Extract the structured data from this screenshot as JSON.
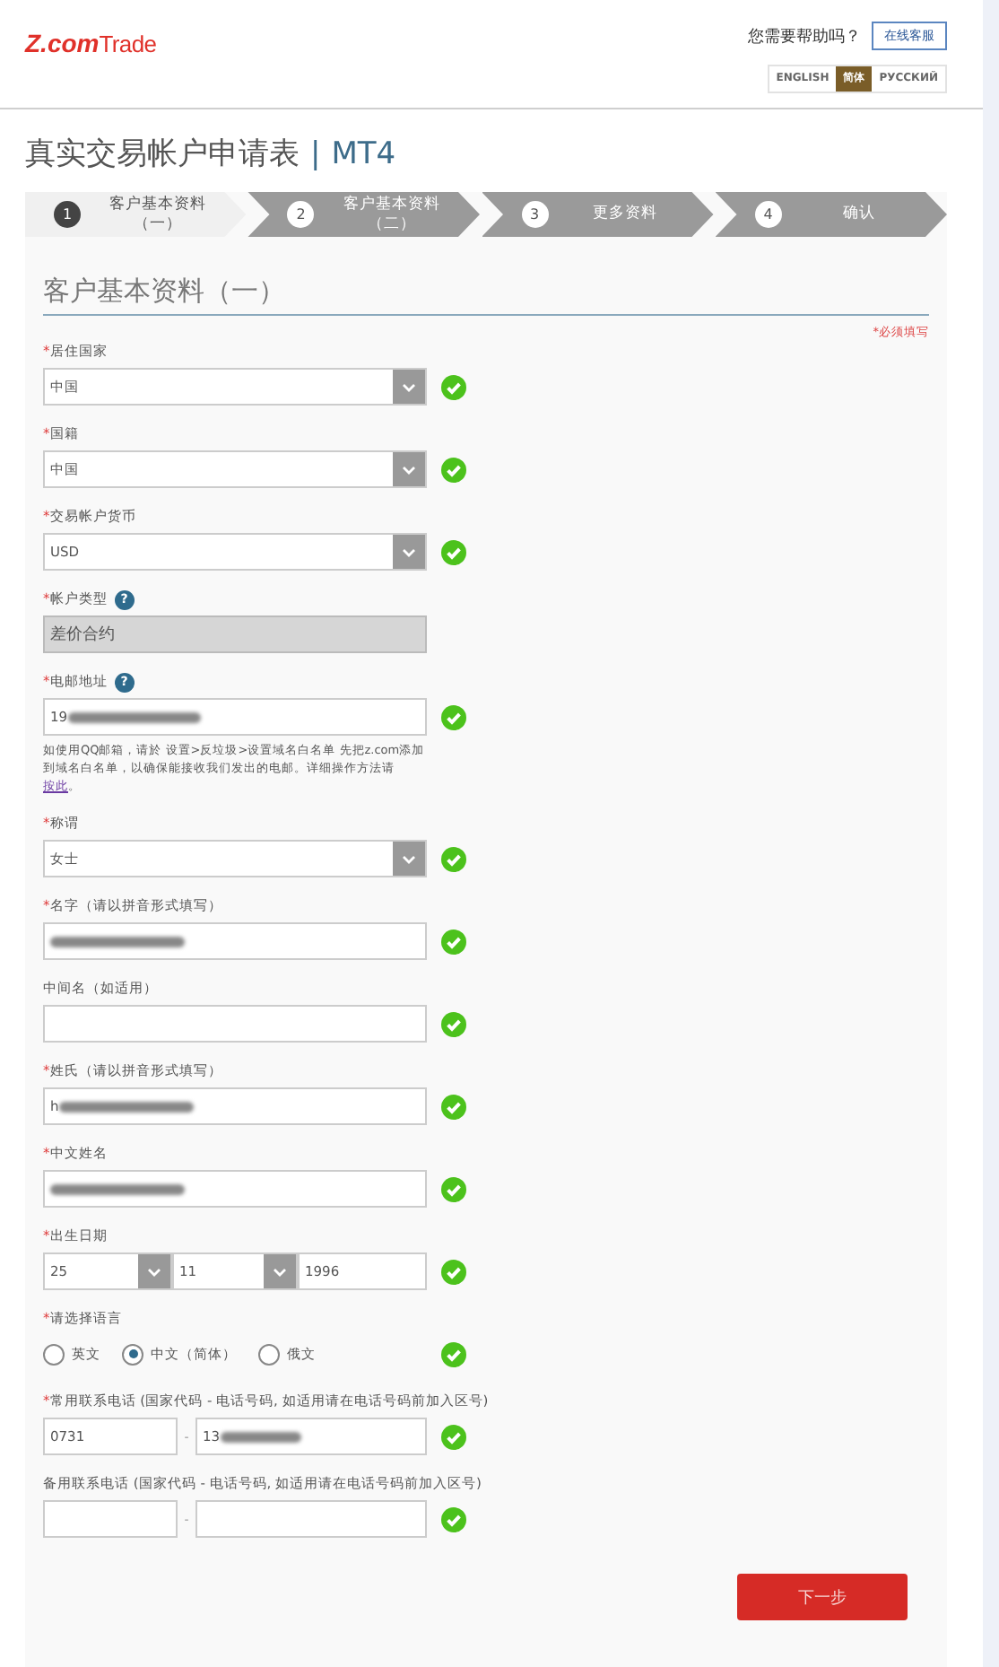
{
  "header": {
    "logo_primary": "Z.com",
    "logo_secondary": "Trade",
    "help_text": "您需要帮助吗？",
    "help_button": "在线客服",
    "languages": [
      {
        "label": "ENGLISH",
        "selected": false
      },
      {
        "label": "简体",
        "selected": true
      },
      {
        "label": "РУССКИЙ",
        "selected": false
      }
    ]
  },
  "title": "真实交易帐户申请表",
  "title_separator": "|",
  "title_suffix": "MT4",
  "steps": [
    {
      "number": "1",
      "label": "客户基本资料（一）",
      "selected": true
    },
    {
      "number": "2",
      "label": "客户基本资料（二）",
      "selected": false
    },
    {
      "number": "3",
      "label": "更多资料",
      "selected": false
    },
    {
      "number": "4",
      "label": "确认",
      "selected": false
    }
  ],
  "section_title": "客户基本资料（一）",
  "required_note": "*必须填写",
  "required_mark": "*",
  "fields": [
    {
      "kind": "select",
      "label": "居住国家",
      "required": true,
      "value": "中国",
      "valid": true
    },
    {
      "kind": "select",
      "label": "国籍",
      "required": true,
      "value": "中国",
      "valid": true
    },
    {
      "kind": "select",
      "label": "交易帐户货币",
      "required": true,
      "value": "USD",
      "valid": true
    },
    {
      "kind": "readonly",
      "label": "帐户类型",
      "required": true,
      "help": "?",
      "value": "差价合约",
      "valid": false
    },
    {
      "kind": "text",
      "label": "电邮地址",
      "required": true,
      "help": "?",
      "value": "19",
      "redacted": true,
      "valid": true,
      "note": "如使用QQ邮箱，请於 设置>反垃圾>设置域名白名单 先把z.com添加到域名白名单，以确保能接收我们发出的电邮。详细操作方法请",
      "note_link": "按此",
      "note_end": "。"
    },
    {
      "kind": "select",
      "label": "称谓",
      "required": true,
      "value": "女士",
      "valid": true
    },
    {
      "kind": "text",
      "label": "名字（请以拼音形式填写）",
      "required": true,
      "redacted": true,
      "valid": true
    },
    {
      "kind": "text",
      "label": "中间名（如适用）",
      "required": false,
      "redacted": false,
      "valid": true
    },
    {
      "kind": "text",
      "label": "姓氏（请以拼音形式填写）",
      "required": true,
      "value": "h",
      "redacted": true,
      "valid": true
    },
    {
      "kind": "text",
      "label": "中文姓名",
      "required": true,
      "redacted": true,
      "valid": true
    },
    {
      "kind": "date",
      "label": "出生日期",
      "required": true,
      "day": "25",
      "month": "11",
      "year": "1996",
      "valid": true
    },
    {
      "kind": "radio",
      "label": "请选择语言",
      "required": true,
      "options": [
        {
          "label": "英文",
          "selected": false
        },
        {
          "label": "中文（简体）",
          "selected": true
        },
        {
          "label": "俄文",
          "selected": false
        }
      ],
      "valid": true
    },
    {
      "kind": "phone",
      "label": "常用联系电话 (国家代码 - 电话号码, 如适用请在电话号码前加入区号)",
      "required": true,
      "code": "0731",
      "separator": "-",
      "number": "13",
      "redacted": true,
      "valid": true
    },
    {
      "kind": "phone",
      "label": "备用联系电话 (国家代码 - 电话号码, 如适用请在电话号码前加入区号)",
      "required": false,
      "separator": "-",
      "redacted": false,
      "valid": true
    }
  ],
  "next_button": "下一步"
}
